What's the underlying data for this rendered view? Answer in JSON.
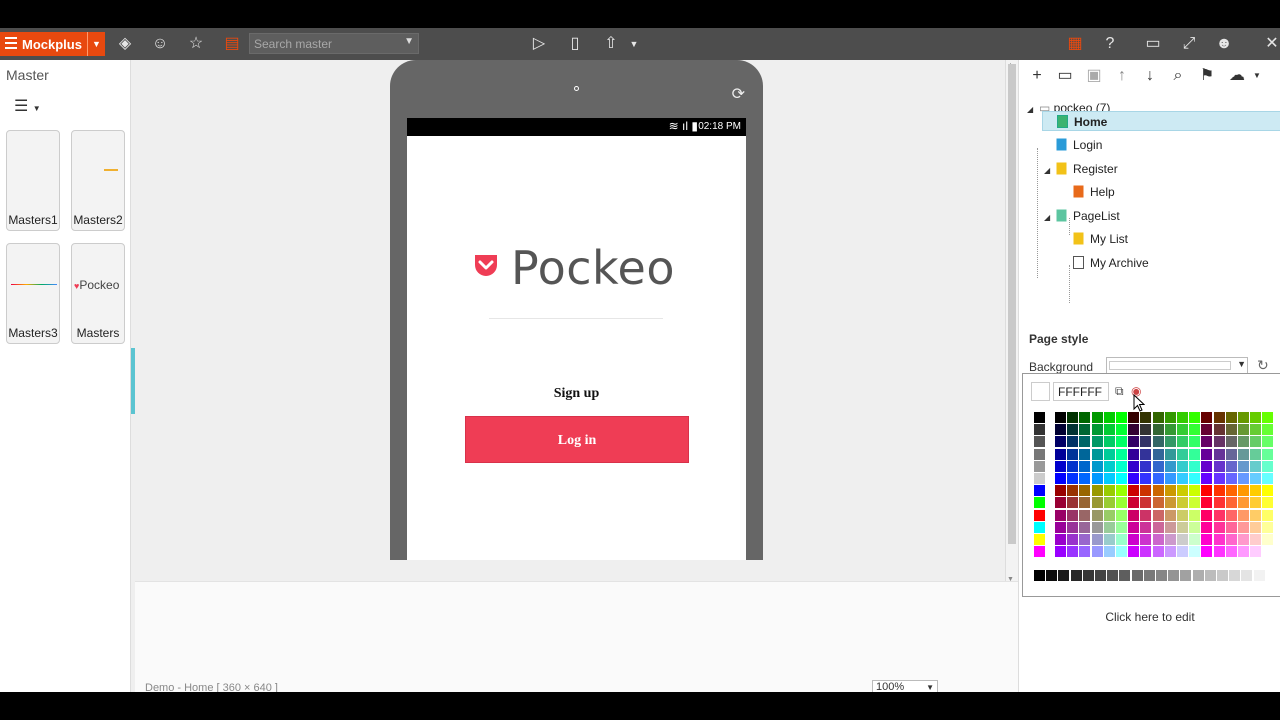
{
  "toolbar": {
    "brand": "Mockplus",
    "search_placeholder": "Search master",
    "icons": [
      "component-icon",
      "smiley-icon",
      "star-icon",
      "widget-icon",
      "play-icon",
      "phone-icon",
      "upload-icon",
      "grid-icon",
      "help-icon",
      "window-icon",
      "fullscreen-icon",
      "avatar-icon",
      "close-icon"
    ]
  },
  "left_panel": {
    "title": "Master",
    "masters": [
      {
        "label": "Masters1"
      },
      {
        "label": "Masters2"
      },
      {
        "label": "Masters3"
      },
      {
        "label": "Masters",
        "preview_text": "Pockeo"
      }
    ]
  },
  "device": {
    "status_time": "02:18 PM",
    "logo_text": "Pockeo",
    "signup_label": "Sign up",
    "login_label": "Log in",
    "accent_color": "#ef3d55"
  },
  "footer": {
    "status": "Demo - Home [ 360 × 640 ]",
    "zoom": "100%"
  },
  "right_panel": {
    "tree": {
      "root": "pockeo (7)",
      "items": [
        {
          "label": "Home"
        },
        {
          "label": "Login"
        },
        {
          "label": "Register"
        },
        {
          "label": "Help"
        },
        {
          "label": "PageList"
        },
        {
          "label": "My List"
        },
        {
          "label": "My Archive"
        }
      ]
    },
    "page_style_title": "Page style",
    "background_label": "Background",
    "picker": {
      "hex_value": "FFFFFF"
    },
    "click_to_edit": "Click here to edit"
  }
}
